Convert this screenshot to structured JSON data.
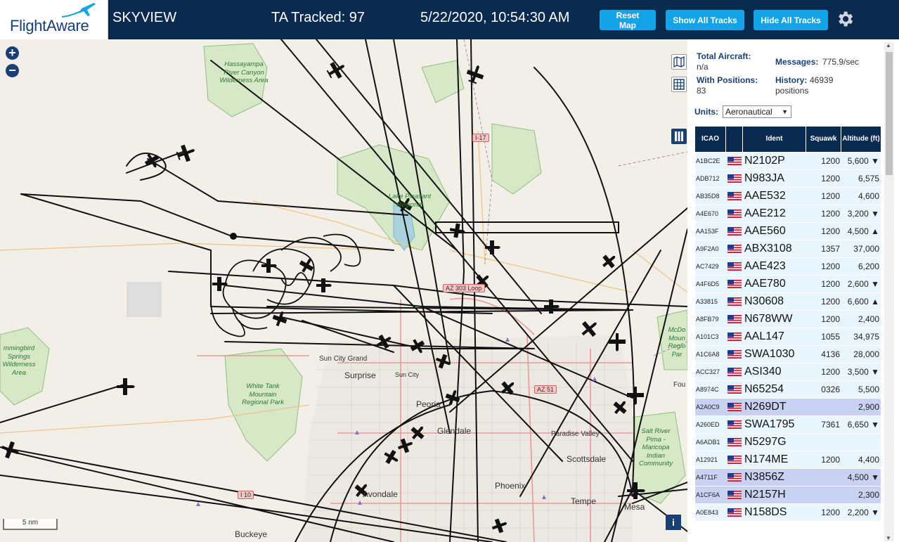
{
  "header": {
    "logo_text": "FlightAware",
    "site_name": "SKYVIEW",
    "tracked_text": "TA Tracked: 97",
    "clock": "5/22/2020, 10:54:30 AM",
    "buttons": {
      "reset": "Reset Map",
      "show_all": "Show All Tracks",
      "hide_all": "Hide All Tracks"
    },
    "settings_icon": "gear-icon"
  },
  "map": {
    "zoom_in": "+",
    "zoom_out": "−",
    "scale": "5 nm",
    "info": "i",
    "places": [
      "Surprise",
      "Peoria",
      "Glendale",
      "Scottsdale",
      "Phoenix",
      "Paradise Valley",
      "Sun City Grand",
      "Sun City",
      "Buckeye",
      "Tempe",
      "Mesa",
      "Avondale",
      "Fou"
    ],
    "parks": [
      "Hassayampa River Canyon Wilderness Area",
      "Lake Pleasant Regional",
      "White Tank Mountain Regional Park",
      "mmingbird Springs Wilderness Area",
      "Salt River Pima - Maricopa Indian Community",
      "McDo Moun Regio Par"
    ],
    "roads": [
      "I-17",
      "AZ 303 Loop",
      "I 10",
      "AZ 51"
    ]
  },
  "stats": {
    "total_aircraft_label": "Total Aircraft:",
    "total_aircraft": "n/a",
    "messages_label": "Messages:",
    "messages": "775.9/sec",
    "with_positions_label": "With Positions:",
    "with_positions": "83",
    "history_label": "History:",
    "history": "46939",
    "history_unit": "positions",
    "units_label": "Units:",
    "units_value": "Aeronautical"
  },
  "table": {
    "headers": {
      "icao": "ICAO",
      "ident": "Ident",
      "squawk": "Squawk",
      "altitude": "Altitude (ft)"
    },
    "rows": [
      {
        "icao": "A1BC2E",
        "ident": "N2102P",
        "squawk": "1200",
        "alt": "5,600 ▼",
        "sel": false
      },
      {
        "icao": "ADB712",
        "ident": "N983JA",
        "squawk": "1200",
        "alt": "6,575",
        "sel": false
      },
      {
        "icao": "AB35D8",
        "ident": "AAE532",
        "squawk": "1200",
        "alt": "4,600",
        "sel": false
      },
      {
        "icao": "A4E670",
        "ident": "AAE212",
        "squawk": "1200",
        "alt": "3,200 ▼",
        "sel": false
      },
      {
        "icao": "AA153F",
        "ident": "AAE560",
        "squawk": "1200",
        "alt": "4,500 ▲",
        "sel": false
      },
      {
        "icao": "A9F2A0",
        "ident": "ABX3108",
        "squawk": "1357",
        "alt": "37,000",
        "sel": false
      },
      {
        "icao": "AC7429",
        "ident": "AAE423",
        "squawk": "1200",
        "alt": "6,200",
        "sel": false
      },
      {
        "icao": "A4F6D5",
        "ident": "AAE780",
        "squawk": "1200",
        "alt": "2,600 ▼",
        "sel": false
      },
      {
        "icao": "A33815",
        "ident": "N30608",
        "squawk": "1200",
        "alt": "6,600 ▲",
        "sel": false
      },
      {
        "icao": "A8FB79",
        "ident": "N678WW",
        "squawk": "1200",
        "alt": "2,400",
        "sel": false
      },
      {
        "icao": "A101C3",
        "ident": "AAL147",
        "squawk": "1055",
        "alt": "34,975",
        "sel": false
      },
      {
        "icao": "A1C6A8",
        "ident": "SWA1030",
        "squawk": "4136",
        "alt": "28,000",
        "sel": false
      },
      {
        "icao": "ACC327",
        "ident": "ASI340",
        "squawk": "1200",
        "alt": "3,500 ▼",
        "sel": false
      },
      {
        "icao": "A8974C",
        "ident": "N65254",
        "squawk": "0326",
        "alt": "5,500",
        "sel": false
      },
      {
        "icao": "A2A0C9",
        "ident": "N269DT",
        "squawk": "",
        "alt": "2,900",
        "sel": true
      },
      {
        "icao": "A260ED",
        "ident": "SWA1795",
        "squawk": "7361",
        "alt": "6,650 ▼",
        "sel": false
      },
      {
        "icao": "A6ADB1",
        "ident": "N5297G",
        "squawk": "",
        "alt": "",
        "sel": false
      },
      {
        "icao": "A12921",
        "ident": "N174ME",
        "squawk": "1200",
        "alt": "4,400",
        "sel": false
      },
      {
        "icao": "A4711F",
        "ident": "N3856Z",
        "squawk": "",
        "alt": "4,500 ▼",
        "sel": true
      },
      {
        "icao": "A1CF6A",
        "ident": "N2157H",
        "squawk": "",
        "alt": "2,300",
        "sel": true
      },
      {
        "icao": "A0E843",
        "ident": "N158DS",
        "squawk": "1200",
        "alt": "2,200 ▼",
        "sel": false
      }
    ]
  },
  "colors": {
    "header_bg": "#0b2a4f",
    "button": "#14a3e6",
    "row": "#eaf6fd",
    "row_selected": "#c9d2f2"
  }
}
